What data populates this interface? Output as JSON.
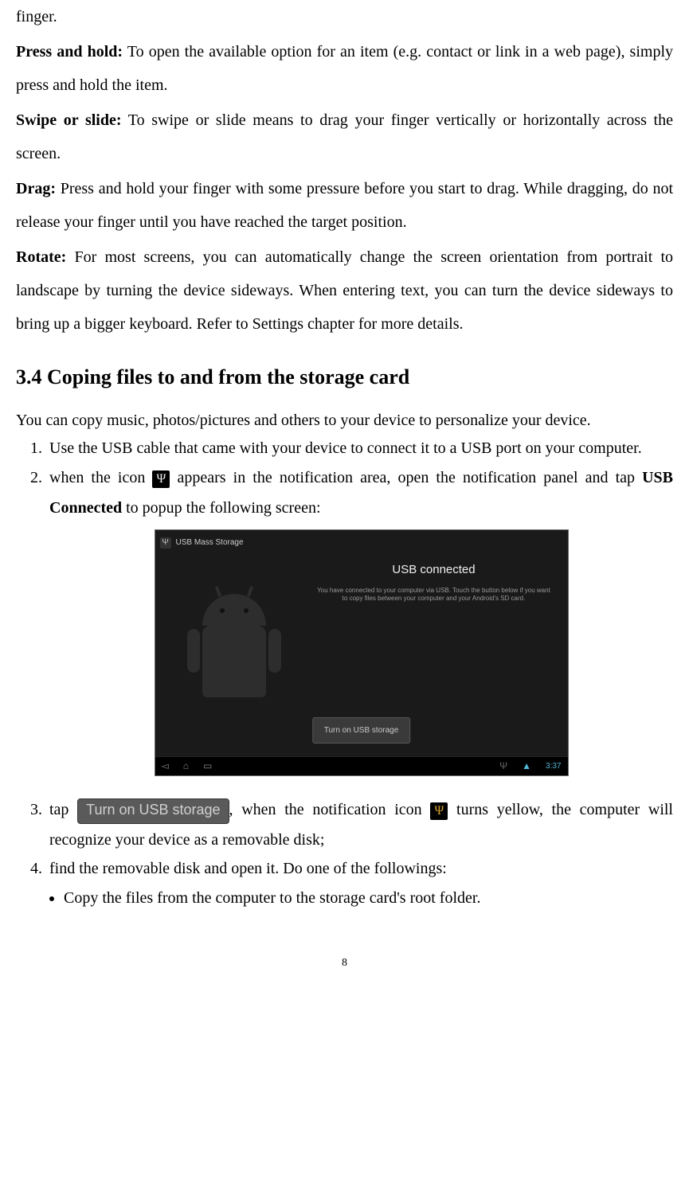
{
  "gestures": {
    "finger": "finger.",
    "pressHold": {
      "label": "Press and hold:",
      "text": " To open the available option for an item (e.g. contact or link in a web page), simply press and hold the item."
    },
    "swipe": {
      "label": "Swipe or slide:",
      "text": " To swipe or slide means to drag your finger vertically or horizontally across the screen."
    },
    "drag": {
      "label": "Drag:",
      "text": " Press and hold your finger with some pressure before you start to drag. While dragging, do not release your finger until you have reached the target position."
    },
    "rotate": {
      "label": "Rotate:",
      "text": " For most screens, you can automatically change the screen orientation from portrait to landscape by turning the device sideways. When entering text, you can turn the device sideways to bring up a bigger keyboard. Refer to Settings chapter for more details."
    }
  },
  "section": {
    "heading": "3.4 Coping files to and from the storage card",
    "intro": "You can copy music, photos/pictures and others to your device to personalize your device.",
    "steps": {
      "s1": "Use the USB cable that came with your device to connect it to a USB port on your computer.",
      "s2a": "when the icon ",
      "s2b": " appears in the notification area, open the notification panel and tap ",
      "s2bold": "USB Connected",
      "s2c": " to popup the following screen:",
      "s3a": "tap ",
      "s3button": "Turn on USB storage",
      "s3b": ", when the notification icon ",
      "s3c": " turns yellow, the computer will recognize your device as a removable disk;",
      "s4": "find the removable disk and open it. Do one of the followings:"
    },
    "bullet1": "Copy the files from the computer to the storage card's root folder."
  },
  "screenshot": {
    "title": "USB Mass Storage",
    "heading": "USB connected",
    "sub": "You have connected to your computer via USB. Touch the button below if you want to copy files between your computer and your Android's SD card.",
    "button": "Turn on USB storage",
    "time": "3:37"
  },
  "pageNumber": "8"
}
